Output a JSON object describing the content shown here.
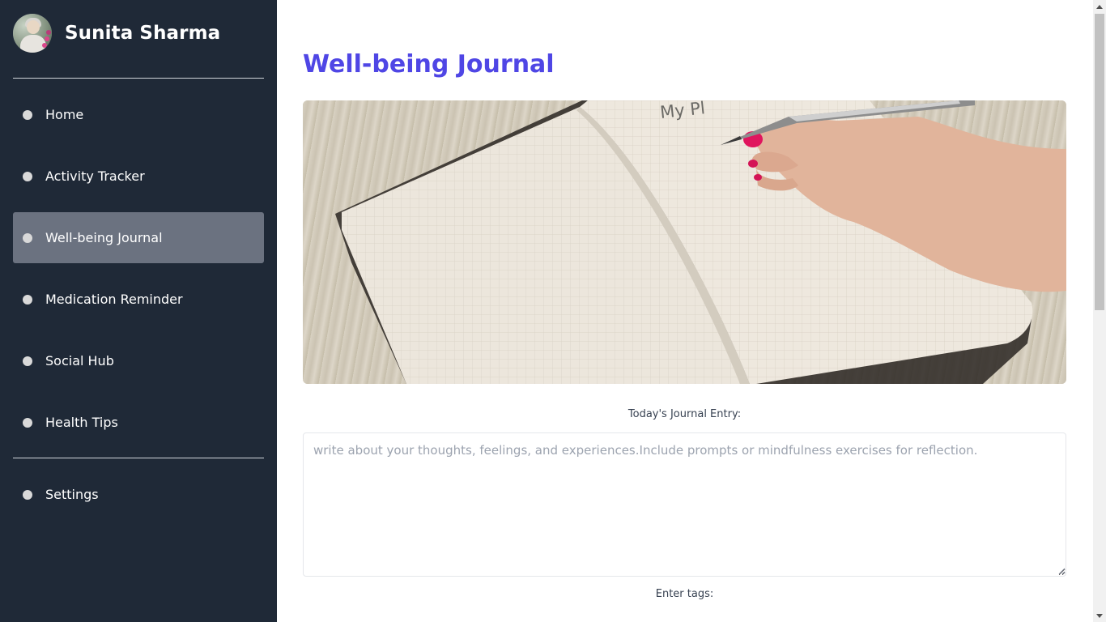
{
  "profile": {
    "name": "Sunita Sharma"
  },
  "nav": {
    "items": [
      {
        "label": "Home",
        "active": false
      },
      {
        "label": "Activity Tracker",
        "active": false
      },
      {
        "label": "Well-being Journal",
        "active": true
      },
      {
        "label": "Medication Reminder",
        "active": false
      },
      {
        "label": "Social Hub",
        "active": false
      },
      {
        "label": "Health Tips",
        "active": false
      }
    ],
    "settings": {
      "label": "Settings"
    }
  },
  "main": {
    "title": "Well-being Journal",
    "hero_text": "My Pl",
    "entry": {
      "label": "Today's Journal Entry:",
      "placeholder": "write about your thoughts, feelings, and experiences.Include prompts or mindfulness exercises for reflection."
    },
    "tags": {
      "label": "Enter tags:"
    }
  },
  "colors": {
    "sidebar_bg": "#1f2937",
    "active_item": "#6b7280",
    "title_accent": "#4f46e5"
  }
}
